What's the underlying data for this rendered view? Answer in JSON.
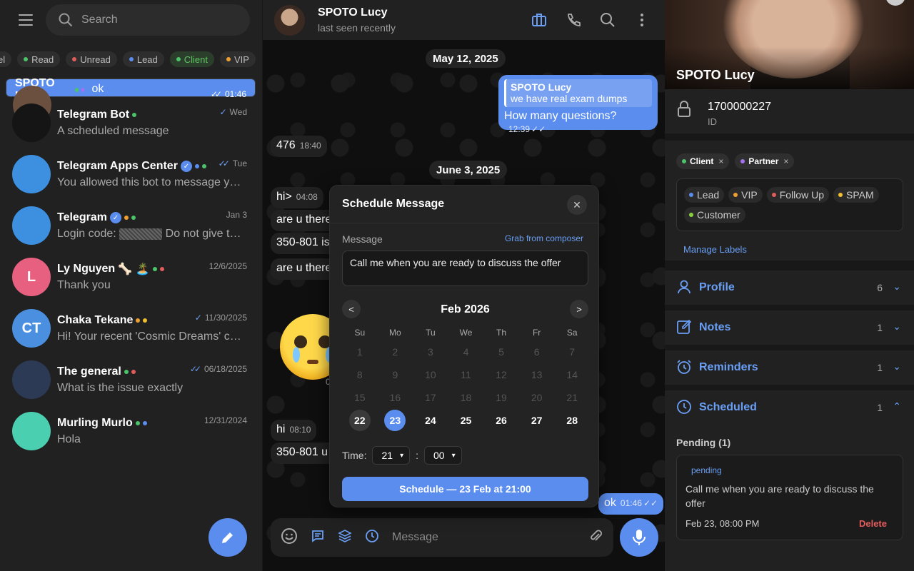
{
  "left": {
    "search_placeholder": "Search",
    "labels": [
      {
        "name": "el",
        "color": "",
        "active": false
      },
      {
        "name": "Read",
        "color": "#4cc46a",
        "active": false
      },
      {
        "name": "Unread",
        "color": "#e25c5c",
        "active": false
      },
      {
        "name": "Lead",
        "color": "#5b8def",
        "active": false
      },
      {
        "name": "Client",
        "color": "#4cc46a",
        "active": true
      },
      {
        "name": "VIP",
        "color": "#f0a030",
        "active": false
      }
    ],
    "chats": [
      {
        "name": "SPOTO Lucy",
        "msg": "ok",
        "date": "01:46",
        "ticks": "✓✓",
        "dots": [
          "#4cc46a",
          "#a770f0"
        ],
        "verified": false,
        "avatar_bg": "#6b4f3f",
        "avatar_text": "",
        "selected": true
      },
      {
        "name": "Telegram Bot",
        "msg": "A scheduled message",
        "date": "Wed",
        "ticks": "✓",
        "dots": [
          "#4cc46a"
        ],
        "verified": false,
        "avatar_bg": "#151515",
        "avatar_text": "",
        "selected": false
      },
      {
        "name": "Telegram Apps Center",
        "msg": "You allowed this bot to message you when y…",
        "date": "Tue",
        "ticks": "✓✓",
        "dots": [
          "#5b8def",
          "#4cc46a"
        ],
        "verified": true,
        "avatar_bg": "#3d8fe0",
        "avatar_text": "",
        "selected": false
      },
      {
        "name": "Telegram",
        "msg_pre": "Login code: ",
        "msg_post": " Do not give this code to anyone",
        "date": "Jan 3",
        "ticks": "",
        "dots": [
          "#f0a030",
          "#4cc46a"
        ],
        "verified": true,
        "avatar_bg": "#3d8fe0",
        "avatar_text": "",
        "selected": false
      },
      {
        "name": "Ly Nguyen",
        "emoji": "🦴 🏝️",
        "msg": "Thank you",
        "date": "12/6/2025",
        "ticks": "",
        "dots": [
          "#4cc46a",
          "#e25c5c"
        ],
        "verified": false,
        "avatar_bg": "#e8607f",
        "avatar_text": "L",
        "selected": false
      },
      {
        "name": "Chaka Tekane",
        "msg": "Hi! Your recent 'Cosmic Dreams' collection is…",
        "date": "11/30/2025",
        "ticks": "✓",
        "dots": [
          "#f0a030",
          "#f0c030"
        ],
        "verified": false,
        "avatar_bg": "#4a8fe0",
        "avatar_text": "CT",
        "selected": false
      },
      {
        "name": "The general",
        "msg": "What is the issue exactly",
        "date": "06/18/2025",
        "ticks": "✓✓",
        "dots": [
          "#4cc46a",
          "#e25c5c"
        ],
        "verified": false,
        "avatar_bg": "#2c3a55",
        "avatar_text": "",
        "selected": false
      },
      {
        "name": "Murling Murlo",
        "msg": "Hola",
        "date": "12/31/2024",
        "ticks": "",
        "dots": [
          "#4cc46a",
          "#5b8def"
        ],
        "verified": false,
        "avatar_bg": "#4ad0b0",
        "avatar_text": "",
        "selected": false
      }
    ]
  },
  "chat": {
    "title": "SPOTO Lucy",
    "status": "last seen recently",
    "date1": "May 12, 2025",
    "date2": "June 3, 2025",
    "quote_author": "SPOTO Lucy",
    "quote_text": "we have real exam dumps",
    "out1_text": "How many questions?",
    "out1_time": "12:39",
    "in1_text": "476",
    "in1_time": "18:40",
    "in2_text": "hi>",
    "in2_time": "04:08",
    "in3_text": "are u there",
    "in4_text": "350-801 is",
    "in5_text": "are u there",
    "in6_text": "hi",
    "in6_time": "08:10",
    "in7_text": "350-801 u",
    "sticker_time": "0",
    "out2_text": "ok",
    "out2_time": "01:46",
    "composer_placeholder": "Message"
  },
  "modal": {
    "title": "Schedule Message",
    "message_label": "Message",
    "grab_label": "Grab from composer",
    "message_value": "Call me when you are ready to discuss the offer",
    "prev": "<",
    "next": ">",
    "month": "Feb 2026",
    "dow": [
      "Su",
      "Mo",
      "Tu",
      "We",
      "Th",
      "Fr",
      "Sa"
    ],
    "weeks": [
      [
        "1",
        "2",
        "3",
        "4",
        "5",
        "6",
        "7"
      ],
      [
        "8",
        "9",
        "10",
        "11",
        "12",
        "13",
        "14"
      ],
      [
        "15",
        "16",
        "17",
        "18",
        "19",
        "20",
        "21"
      ],
      [
        "22",
        "23",
        "24",
        "25",
        "26",
        "27",
        "28"
      ]
    ],
    "today": "22",
    "picked": "23",
    "time_label": "Time:",
    "hour": "21",
    "minute": "00",
    "colon": ":",
    "button": "Schedule — 23 Feb at 21:00"
  },
  "profile": {
    "name": "SPOTO Lucy",
    "id_value": "1700000227",
    "id_label": "ID",
    "tags": [
      {
        "name": "Client",
        "color": "#4cc46a",
        "x": "×"
      },
      {
        "name": "Partner",
        "color": "#a770f0",
        "x": "×"
      }
    ],
    "labels": [
      {
        "name": "Lead",
        "color": "#5b8def"
      },
      {
        "name": "VIP",
        "color": "#f0a030"
      },
      {
        "name": "Follow Up",
        "color": "#e25c5c"
      },
      {
        "name": "SPAM",
        "color": "#f0c030"
      },
      {
        "name": "Customer",
        "color": "#8bd040"
      }
    ],
    "manage_labels": "Manage Labels",
    "sections": [
      {
        "label": "Profile",
        "count": "6",
        "chev": "⌄"
      },
      {
        "label": "Notes",
        "count": "1",
        "chev": "⌄"
      },
      {
        "label": "Reminders",
        "count": "1",
        "chev": "⌄"
      },
      {
        "label": "Scheduled",
        "count": "1",
        "chev": "⌃"
      }
    ],
    "pending_header": "Pending (1)",
    "pending_badge": "pending",
    "pending_text": "Call me when you are ready to discuss the offer",
    "pending_date": "Feb 23, 08:00 PM",
    "delete_label": "Delete"
  },
  "colors": {
    "accent": "#5b8def",
    "danger": "#e25c5c"
  }
}
